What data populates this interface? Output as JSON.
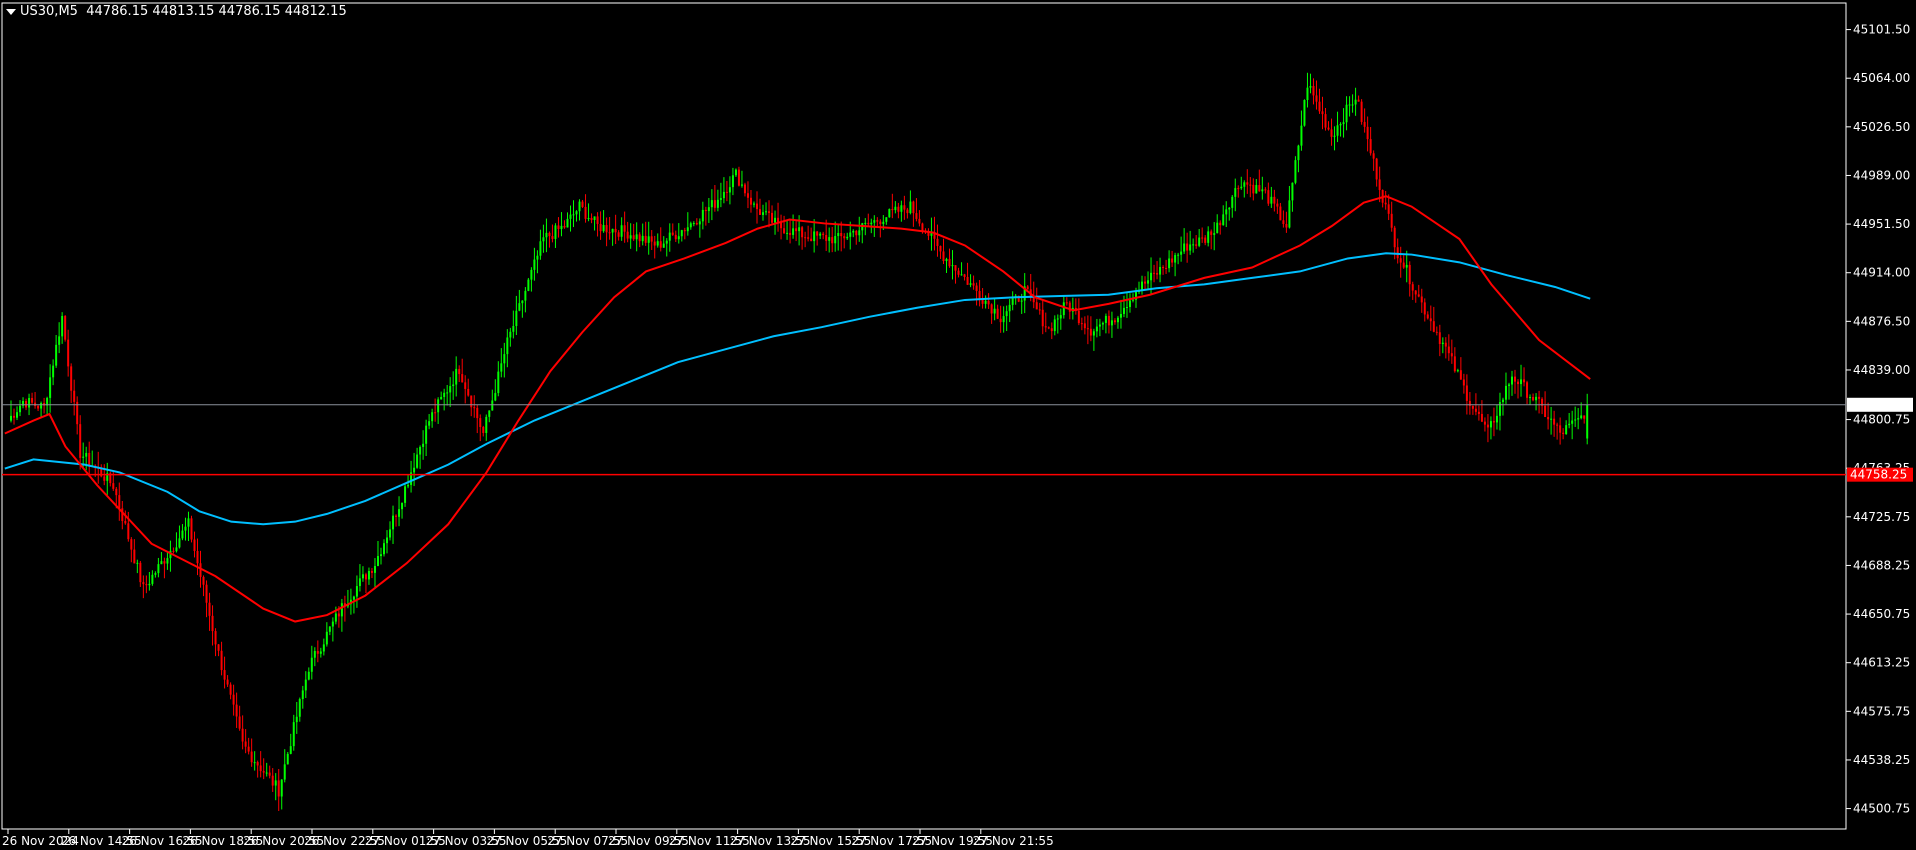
{
  "header": {
    "symbol_label": "US30,M5",
    "ohlc_text": "44786.15 44813.15 44786.15 44812.15"
  },
  "colors": {
    "background": "#000000",
    "axis": "#ffffff",
    "bull": "#00ff00",
    "bear": "#ff0000",
    "ma_fast": "#ff0000",
    "ma_slow": "#00bfff",
    "bid_line": "#8a8f9a",
    "level_line": "#ff0000"
  },
  "chart_data": {
    "type": "candlestick",
    "symbol": "US30",
    "timeframe": "M5",
    "ylim": [
      44485,
      45122
    ],
    "y_ticks": [
      "45101.50",
      "45064.00",
      "45026.50",
      "44989.00",
      "44951.50",
      "44914.00",
      "44876.50",
      "44839.00",
      "44800.75",
      "44763.25",
      "44725.75",
      "44688.25",
      "44650.75",
      "44613.25",
      "44575.75",
      "44538.25",
      "44500.75"
    ],
    "x_ticks": [
      "26 Nov 2024",
      "26 Nov 14:55",
      "26 Nov 16:55",
      "26 Nov 18:55",
      "26 Nov 20:55",
      "26 Nov 22:55",
      "27 Nov 01:55",
      "27 Nov 03:55",
      "27 Nov 05:55",
      "27 Nov 07:55",
      "27 Nov 09:55",
      "27 Nov 11:55",
      "27 Nov 13:55",
      "27 Nov 15:55",
      "27 Nov 17:55",
      "27 Nov 19:55",
      "27 Nov 21:55"
    ],
    "bars_per_tick": 19,
    "bar_count": 320,
    "price_anchors": [
      [
        0,
        44800
      ],
      [
        5,
        44815
      ],
      [
        12,
        44810
      ],
      [
        18,
        44880
      ],
      [
        24,
        44775
      ],
      [
        35,
        44750
      ],
      [
        45,
        44670
      ],
      [
        60,
        44720
      ],
      [
        70,
        44620
      ],
      [
        78,
        44550
      ],
      [
        90,
        44515
      ],
      [
        100,
        44610
      ],
      [
        112,
        44660
      ],
      [
        122,
        44690
      ],
      [
        130,
        44735
      ],
      [
        140,
        44800
      ],
      [
        150,
        44840
      ],
      [
        158,
        44790
      ],
      [
        166,
        44860
      ],
      [
        172,
        44900
      ],
      [
        178,
        44940
      ],
      [
        185,
        44950
      ],
      [
        190,
        44965
      ],
      [
        196,
        44950
      ],
      [
        206,
        44945
      ],
      [
        216,
        44935
      ],
      [
        226,
        44950
      ],
      [
        235,
        44968
      ],
      [
        242,
        44990
      ],
      [
        248,
        44965
      ],
      [
        256,
        44950
      ],
      [
        266,
        44942
      ],
      [
        276,
        44940
      ],
      [
        285,
        44950
      ],
      [
        292,
        44958
      ],
      [
        300,
        44965
      ],
      [
        310,
        44930
      ],
      [
        320,
        44905
      ]
    ],
    "last_bar": {
      "open": 44786.15,
      "high": 44813.15,
      "low": 44786.15,
      "close": 44812.15
    },
    "ma_fast": [
      [
        -1,
        44790
      ],
      [
        8,
        44800
      ],
      [
        13,
        44805
      ],
      [
        18,
        44780
      ],
      [
        28,
        44750
      ],
      [
        45,
        44705
      ],
      [
        65,
        44680
      ],
      [
        80,
        44655
      ],
      [
        90,
        44645
      ],
      [
        100,
        44650
      ],
      [
        112,
        44665
      ],
      [
        125,
        44690
      ],
      [
        138,
        44720
      ],
      [
        150,
        44760
      ],
      [
        160,
        44800
      ],
      [
        170,
        44838
      ],
      [
        180,
        44868
      ],
      [
        190,
        44895
      ],
      [
        200,
        44915
      ],
      [
        212,
        44925
      ],
      [
        225,
        44937
      ],
      [
        235,
        44948
      ],
      [
        245,
        44955
      ],
      [
        256,
        44952
      ],
      [
        268,
        44950
      ],
      [
        280,
        44948
      ],
      [
        290,
        44945
      ],
      [
        300,
        44935
      ],
      [
        312,
        44915
      ],
      [
        322,
        44895
      ],
      [
        334,
        44885
      ],
      [
        345,
        44890
      ],
      [
        358,
        44897
      ],
      [
        375,
        44910
      ],
      [
        390,
        44918
      ],
      [
        405,
        44935
      ],
      [
        415,
        44950
      ],
      [
        425,
        44968
      ],
      [
        432,
        44973
      ],
      [
        440,
        44965
      ],
      [
        455,
        44940
      ],
      [
        465,
        44905
      ],
      [
        480,
        44862
      ],
      [
        496,
        44832
      ]
    ],
    "ma_slow": [
      [
        -1,
        44763
      ],
      [
        8,
        44770
      ],
      [
        16,
        44768
      ],
      [
        24,
        44766
      ],
      [
        35,
        44760
      ],
      [
        50,
        44745
      ],
      [
        60,
        44730
      ],
      [
        70,
        44722
      ],
      [
        80,
        44720
      ],
      [
        90,
        44722
      ],
      [
        100,
        44728
      ],
      [
        112,
        44738
      ],
      [
        125,
        44752
      ],
      [
        138,
        44766
      ],
      [
        150,
        44782
      ],
      [
        165,
        44800
      ],
      [
        180,
        44815
      ],
      [
        195,
        44830
      ],
      [
        210,
        44845
      ],
      [
        225,
        44855
      ],
      [
        240,
        44865
      ],
      [
        255,
        44872
      ],
      [
        270,
        44880
      ],
      [
        285,
        44887
      ],
      [
        300,
        44893
      ],
      [
        315,
        44895
      ],
      [
        330,
        44896
      ],
      [
        345,
        44897
      ],
      [
        360,
        44902
      ],
      [
        375,
        44905
      ],
      [
        390,
        44910
      ],
      [
        405,
        44915
      ],
      [
        420,
        44925
      ],
      [
        432,
        44929
      ],
      [
        440,
        44928
      ],
      [
        455,
        44922
      ],
      [
        470,
        44912
      ],
      [
        485,
        44903
      ],
      [
        496,
        44894
      ]
    ],
    "horizontal_lines": [
      {
        "price": 44812.15,
        "label": "44812.15",
        "style": "bid"
      },
      {
        "price": 44758.25,
        "label": "44758.25",
        "style": "level"
      }
    ]
  }
}
